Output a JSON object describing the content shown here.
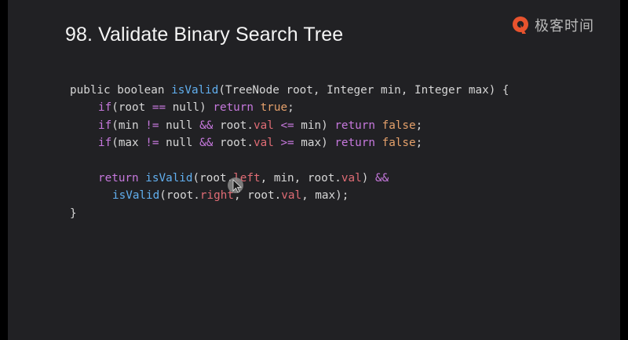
{
  "slide": {
    "title": "98. Validate Binary Search Tree",
    "brand": {
      "name": "极客时间",
      "icon": "geektime-logo-icon",
      "color": "#e8532e"
    }
  },
  "code": {
    "language": "java",
    "lines": [
      [
        {
          "t": "public boolean ",
          "c": "plain"
        },
        {
          "t": "isValid",
          "c": "fn"
        },
        {
          "t": "(TreeNode root, Integer min, Integer max) {",
          "c": "plain"
        }
      ],
      [
        {
          "t": "if",
          "c": "kw"
        },
        {
          "t": "(root ",
          "c": "plain"
        },
        {
          "t": "==",
          "c": "kw"
        },
        {
          "t": " null) ",
          "c": "plain"
        },
        {
          "t": "return",
          "c": "kw"
        },
        {
          "t": " ",
          "c": "plain"
        },
        {
          "t": "true",
          "c": "lit"
        },
        {
          "t": ";",
          "c": "plain"
        }
      ],
      [
        {
          "t": "if",
          "c": "kw"
        },
        {
          "t": "(min ",
          "c": "plain"
        },
        {
          "t": "!=",
          "c": "kw"
        },
        {
          "t": " null ",
          "c": "plain"
        },
        {
          "t": "&&",
          "c": "kw"
        },
        {
          "t": " root.",
          "c": "plain"
        },
        {
          "t": "val",
          "c": "prop"
        },
        {
          "t": " ",
          "c": "plain"
        },
        {
          "t": "<=",
          "c": "kw"
        },
        {
          "t": " min) ",
          "c": "plain"
        },
        {
          "t": "return",
          "c": "kw"
        },
        {
          "t": " ",
          "c": "plain"
        },
        {
          "t": "false",
          "c": "lit"
        },
        {
          "t": ";",
          "c": "plain"
        }
      ],
      [
        {
          "t": "if",
          "c": "kw"
        },
        {
          "t": "(max ",
          "c": "plain"
        },
        {
          "t": "!=",
          "c": "kw"
        },
        {
          "t": " null ",
          "c": "plain"
        },
        {
          "t": "&&",
          "c": "kw"
        },
        {
          "t": " root.",
          "c": "plain"
        },
        {
          "t": "val",
          "c": "prop"
        },
        {
          "t": " ",
          "c": "plain"
        },
        {
          "t": ">=",
          "c": "kw"
        },
        {
          "t": " max) ",
          "c": "plain"
        },
        {
          "t": "return",
          "c": "kw"
        },
        {
          "t": " ",
          "c": "plain"
        },
        {
          "t": "false",
          "c": "lit"
        },
        {
          "t": ";",
          "c": "plain"
        }
      ],
      [],
      [
        {
          "t": "return",
          "c": "kw"
        },
        {
          "t": " ",
          "c": "plain"
        },
        {
          "t": "isValid",
          "c": "fn"
        },
        {
          "t": "(root.",
          "c": "plain"
        },
        {
          "t": "left",
          "c": "prop"
        },
        {
          "t": ", min, root.",
          "c": "plain"
        },
        {
          "t": "val",
          "c": "prop"
        },
        {
          "t": ") ",
          "c": "plain"
        },
        {
          "t": "&&",
          "c": "kw"
        }
      ],
      [
        {
          "t": "isValid",
          "c": "fn"
        },
        {
          "t": "(root.",
          "c": "plain"
        },
        {
          "t": "right",
          "c": "prop"
        },
        {
          "t": ", root.",
          "c": "plain"
        },
        {
          "t": "val",
          "c": "prop"
        },
        {
          "t": ", max);",
          "c": "plain"
        }
      ],
      [
        {
          "t": "}",
          "c": "plain"
        }
      ]
    ],
    "indent": [
      0,
      1,
      1,
      1,
      0,
      1,
      2,
      0
    ]
  },
  "colors": {
    "background": "#212124",
    "keyword": "#c678dd",
    "function": "#61afef",
    "property": "#e06c75",
    "literal": "#e5a16b",
    "text": "#d6d6d6"
  }
}
